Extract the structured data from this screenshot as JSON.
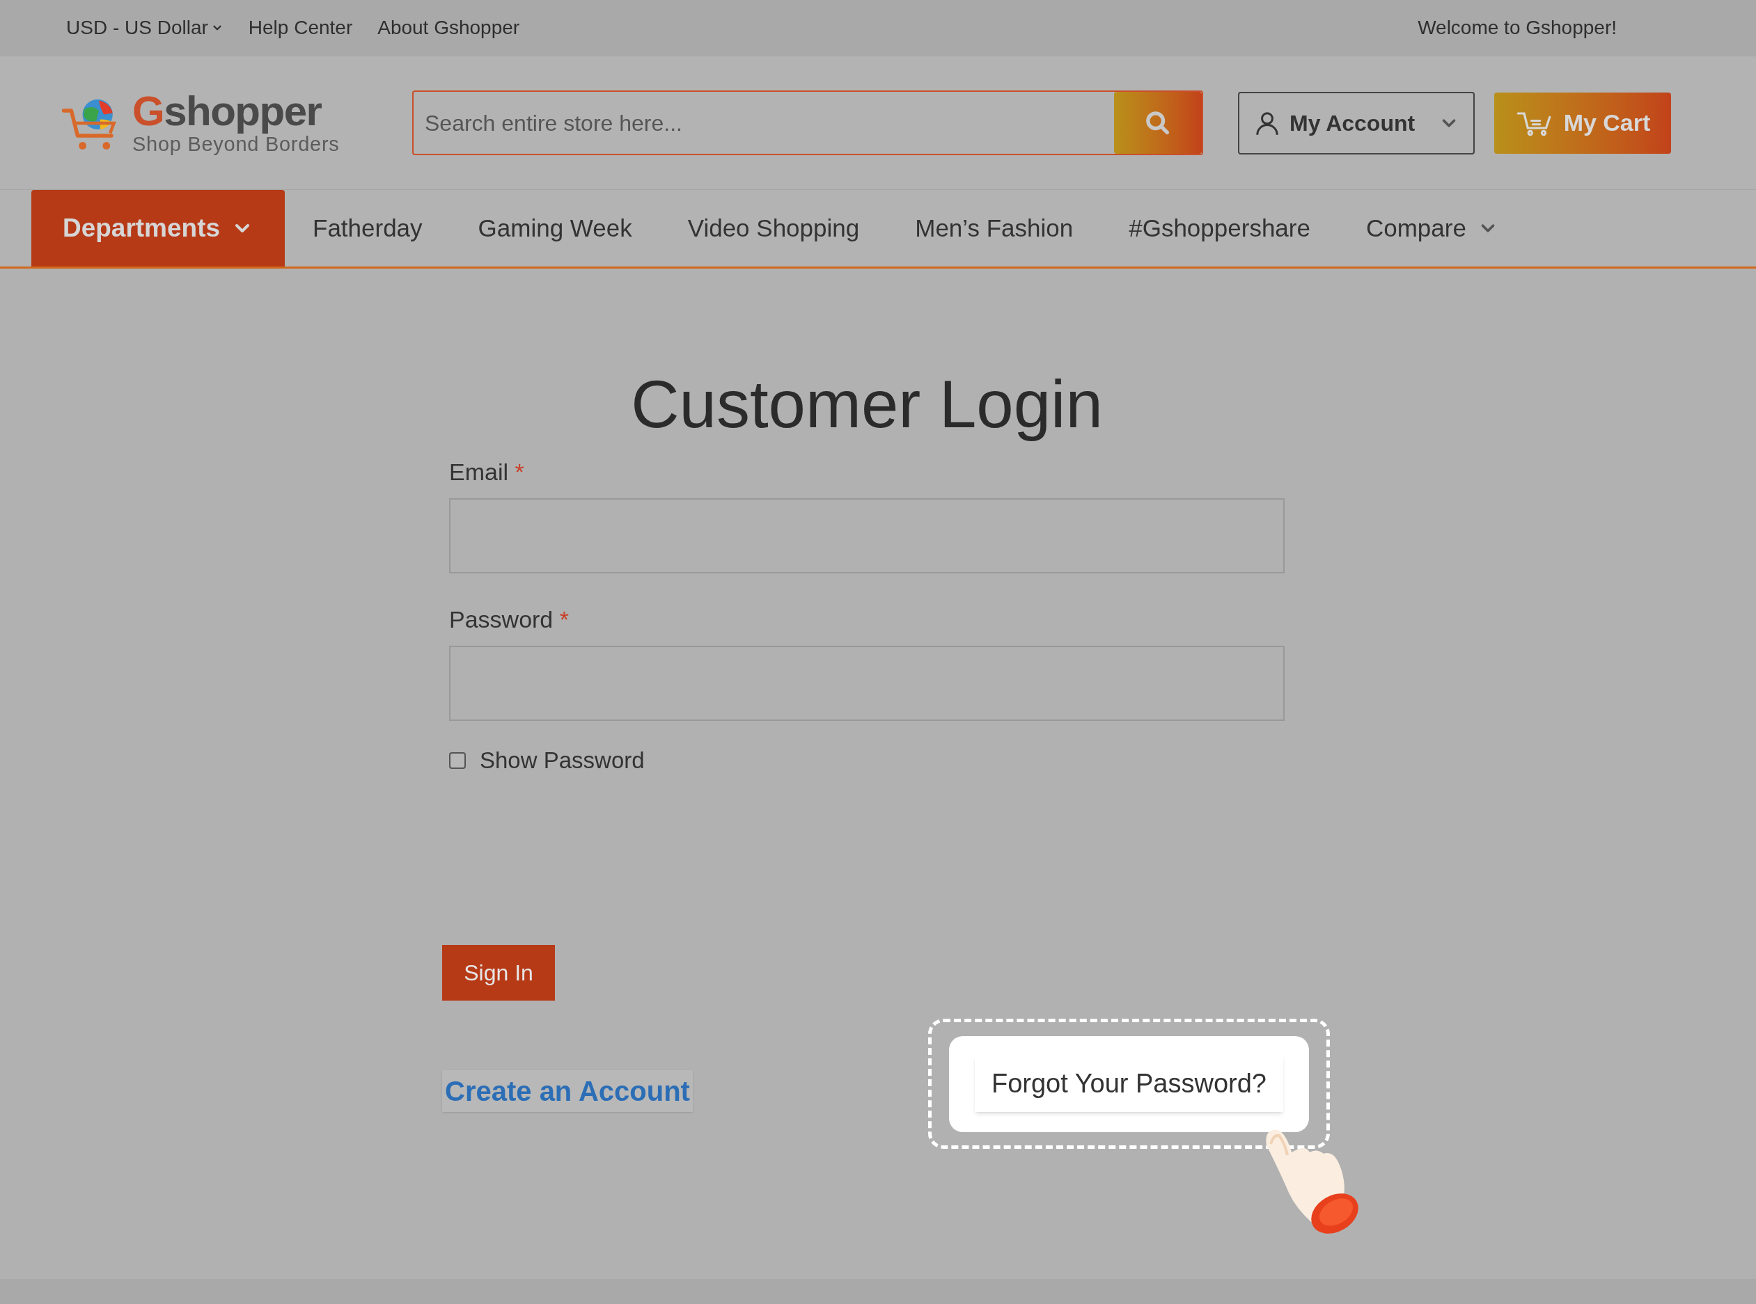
{
  "top_bar": {
    "currency": "USD - US Dollar",
    "links": [
      "Help Center",
      "About Gshopper"
    ],
    "welcome": "Welcome to Gshopper!"
  },
  "header": {
    "logo": {
      "name": "Gshopper",
      "tagline": "Shop Beyond Borders"
    },
    "search": {
      "placeholder": "Search entire store here..."
    },
    "account": "My Account",
    "cart": "My Cart"
  },
  "nav": [
    {
      "label": "Departments",
      "kind": "menu"
    },
    {
      "label": "Fatherday",
      "kind": "link"
    },
    {
      "label": "Gaming Week",
      "kind": "link"
    },
    {
      "label": "Video Shopping",
      "kind": "link"
    },
    {
      "label": "Men’s Fashion",
      "kind": "link"
    },
    {
      "label": "#Gshoppershare",
      "kind": "link"
    },
    {
      "label": "Compare",
      "kind": "dropdown"
    }
  ],
  "login": {
    "title": "Customer Login",
    "fields": [
      {
        "label": "Email",
        "required_mark": "*"
      },
      {
        "label": "Password",
        "required_mark": "*"
      }
    ],
    "show_password": {
      "label": "Show Password",
      "checked": false
    },
    "sign_in": "Sign In",
    "create_account": "Create an Account",
    "forgot": "Forgot Your Password?"
  }
}
